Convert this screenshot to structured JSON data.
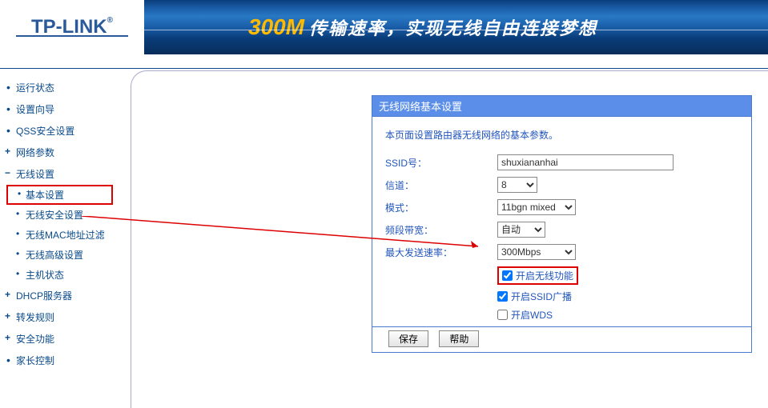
{
  "header": {
    "logo": "TP-LINK",
    "banner_prefix": "300M",
    "banner_text": "传输速率，实现无线自由连接梦想"
  },
  "sidebar": {
    "items": [
      {
        "label": "运行状态",
        "type": "top"
      },
      {
        "label": "设置向导",
        "type": "top"
      },
      {
        "label": "QSS安全设置",
        "type": "top"
      },
      {
        "label": "网络参数",
        "type": "collapsed"
      },
      {
        "label": "无线设置",
        "type": "expanded"
      },
      {
        "label": "基本设置",
        "type": "sub",
        "highlighted": true
      },
      {
        "label": "无线安全设置",
        "type": "sub"
      },
      {
        "label": "无线MAC地址过滤",
        "type": "sub"
      },
      {
        "label": "无线高级设置",
        "type": "sub"
      },
      {
        "label": "主机状态",
        "type": "sub"
      },
      {
        "label": "DHCP服务器",
        "type": "collapsed"
      },
      {
        "label": "转发规则",
        "type": "collapsed"
      },
      {
        "label": "安全功能",
        "type": "collapsed"
      },
      {
        "label": "家长控制",
        "type": "top"
      }
    ]
  },
  "panel": {
    "title": "无线网络基本设置",
    "intro": "本页面设置路由器无线网络的基本参数。",
    "fields": {
      "ssid_label": "SSID号：",
      "ssid_value": "shuxiananhai",
      "channel_label": "信道：",
      "channel_value": "8",
      "mode_label": "模式：",
      "mode_value": "11bgn mixed",
      "bandwidth_label": "频段带宽：",
      "bandwidth_value": "自动",
      "maxrate_label": "最大发送速率：",
      "maxrate_value": "300Mbps"
    },
    "checkboxes": {
      "enable_wireless": "开启无线功能",
      "enable_ssid_broadcast": "开启SSID广播",
      "enable_wds": "开启WDS"
    },
    "buttons": {
      "save": "保存",
      "help": "帮助"
    }
  }
}
